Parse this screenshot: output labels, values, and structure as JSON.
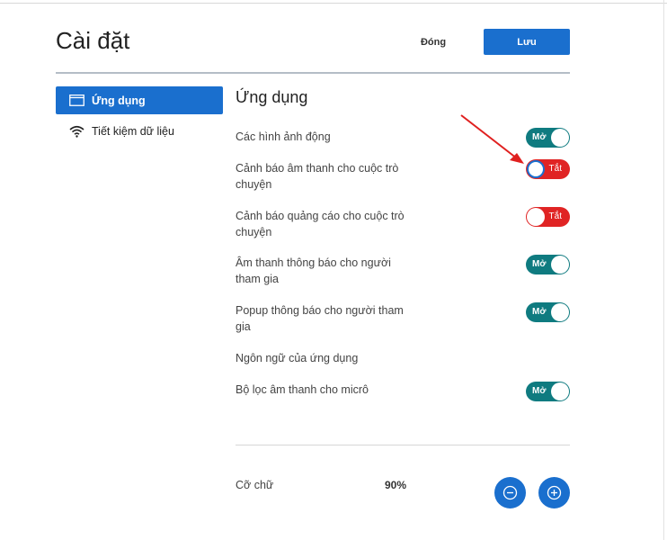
{
  "header": {
    "title": "Cài đặt",
    "close_label": "Đóng",
    "save_label": "Lưu"
  },
  "sidebar": {
    "items": [
      {
        "label": "Ứng dụng",
        "icon": "window-icon",
        "active": true
      },
      {
        "label": "Tiết kiệm dữ liệu",
        "icon": "wifi-icon",
        "active": false
      }
    ]
  },
  "main": {
    "section_title": "Ứng dụng",
    "settings": [
      {
        "label": "Các hình ảnh động",
        "toggle": "Mở",
        "state": "on"
      },
      {
        "label": "Cảnh báo âm thanh cho cuộc trò chuyện",
        "toggle": "Tắt",
        "state": "off"
      },
      {
        "label": "Cảnh báo quảng cáo cho cuộc trò chuyện",
        "toggle": "Tắt",
        "state": "off"
      },
      {
        "label": "Âm thanh thông báo cho người tham gia",
        "toggle": "Mở",
        "state": "on"
      },
      {
        "label": "Popup thông báo cho người tham gia",
        "toggle": "Mở",
        "state": "on"
      },
      {
        "label": "Ngôn ngữ của ứng dụng"
      },
      {
        "label": "Bộ lọc âm thanh cho micrô",
        "toggle": "Mở",
        "state": "on"
      }
    ],
    "font_size": {
      "label": "Cỡ chữ",
      "value": "90%",
      "decrease_icon": "minus-circle-icon",
      "increase_icon": "plus-circle-icon"
    }
  },
  "colors": {
    "accent": "#1a6fce",
    "toggle_on": "#0f7b80",
    "toggle_off": "#e02424",
    "annotation": "#e0201f"
  }
}
